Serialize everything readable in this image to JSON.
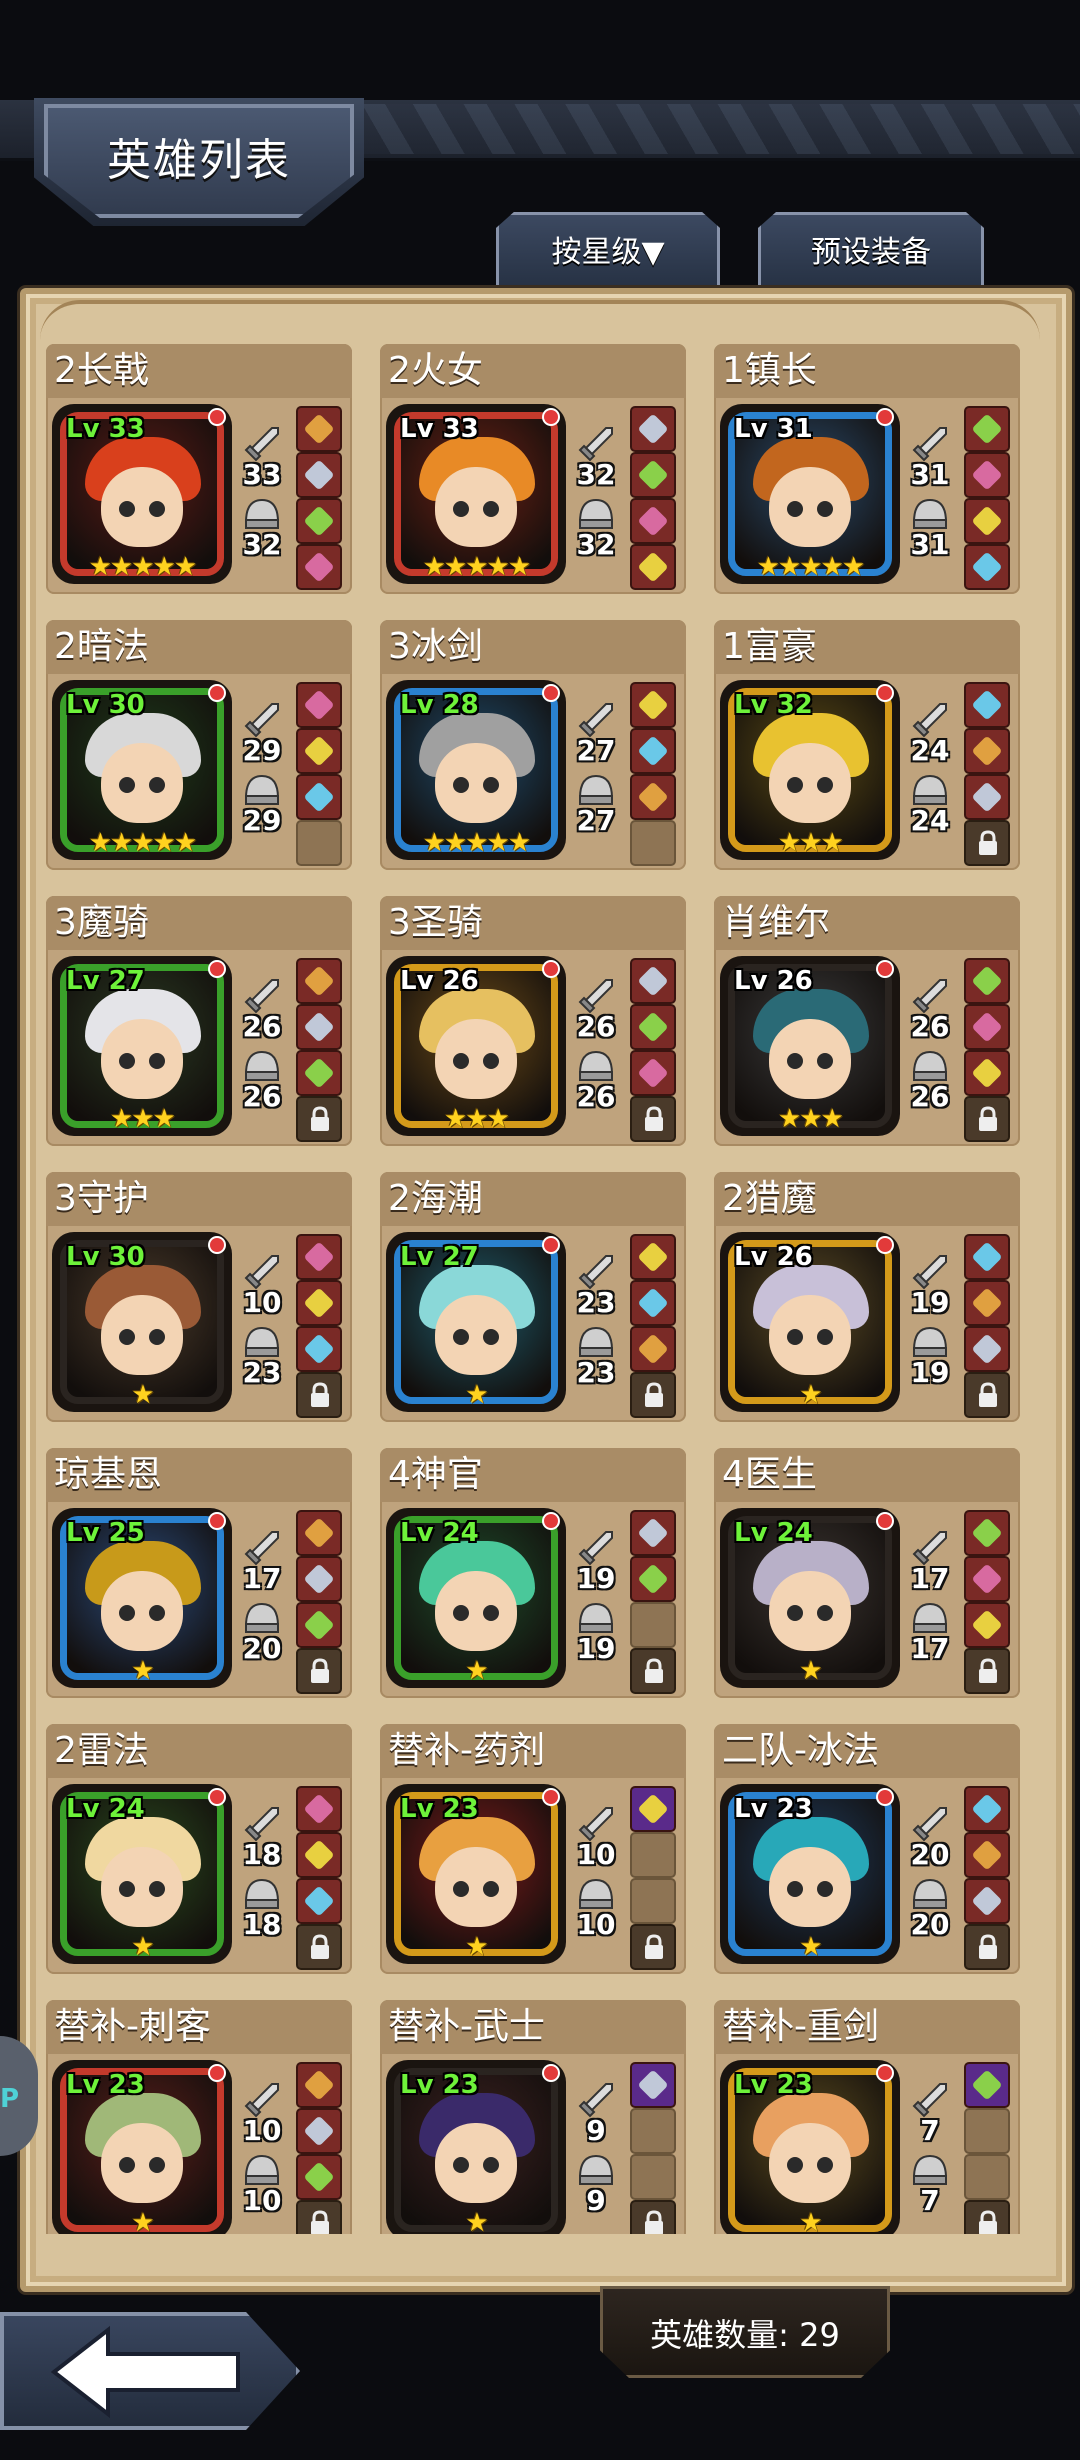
{
  "header": {
    "title": "英雄列表",
    "sort_button": "按星级▼",
    "preset_button": "预设装备"
  },
  "footer": {
    "hero_count": "英雄数量: 29",
    "side_tab": "P"
  },
  "colors": {
    "red_frame": "#c43a2c",
    "blue_frame": "#2a82d0",
    "green_frame": "#3aa02a",
    "gold_frame": "#d49a1a",
    "black_frame": "#2a2420",
    "level_green": "#6ef23a",
    "star": "#ffd21f"
  },
  "heroes": [
    {
      "name": "2长戟",
      "level": "Lv 33",
      "level_color": "green",
      "frame": "red",
      "stars": "★★★★★",
      "atk": "33",
      "def": "32",
      "equip": [
        "item",
        "item",
        "item",
        "item"
      ],
      "hair": "#d9401c",
      "bg": "#5a1a16"
    },
    {
      "name": "2火女",
      "level": "Lv 33",
      "level_color": "white",
      "frame": "red",
      "stars": "★★★★★",
      "atk": "32",
      "def": "32",
      "equip": [
        "item",
        "item",
        "item",
        "item"
      ],
      "hair": "#e88a26",
      "bg": "#6a2014"
    },
    {
      "name": "1镇长",
      "level": "Lv 31",
      "level_color": "white",
      "frame": "blue",
      "stars": "★★★★★",
      "atk": "31",
      "def": "31",
      "equip": [
        "item",
        "item",
        "item",
        "item"
      ],
      "hair": "#c2661e",
      "bg": "#2a4a6a"
    },
    {
      "name": "2暗法",
      "level": "Lv 30",
      "level_color": "green",
      "frame": "green",
      "stars": "★★★★★",
      "atk": "29",
      "def": "29",
      "equip": [
        "item",
        "item",
        "item",
        "empty"
      ],
      "hair": "#d8d8d8",
      "bg": "#1e3a1a"
    },
    {
      "name": "3冰剑",
      "level": "Lv 28",
      "level_color": "green",
      "frame": "blue",
      "stars": "★★★★★",
      "atk": "27",
      "def": "27",
      "equip": [
        "item",
        "item",
        "item",
        "empty"
      ],
      "hair": "#a0a0a0",
      "bg": "#1e4a6a"
    },
    {
      "name": "1富豪",
      "level": "Lv 32",
      "level_color": "green",
      "frame": "gold",
      "stars": "★★★",
      "atk": "24",
      "def": "24",
      "equip": [
        "item",
        "item",
        "item",
        "locked"
      ],
      "hair": "#e8c230",
      "bg": "#5a4a14"
    },
    {
      "name": "3魔骑",
      "level": "Lv 27",
      "level_color": "green",
      "frame": "green",
      "stars": "★★★",
      "atk": "26",
      "def": "26",
      "equip": [
        "item",
        "item",
        "item",
        "locked"
      ],
      "hair": "#e4e4e8",
      "bg": "#2a3a22"
    },
    {
      "name": "3圣骑",
      "level": "Lv 26",
      "level_color": "white",
      "frame": "gold",
      "stars": "★★★",
      "atk": "26",
      "def": "26",
      "equip": [
        "item",
        "item",
        "item",
        "locked"
      ],
      "hair": "#e6c060",
      "bg": "#6a4a18"
    },
    {
      "name": "肖维尔",
      "level": "Lv 26",
      "level_color": "white",
      "frame": "black",
      "stars": "★★★",
      "atk": "26",
      "def": "26",
      "equip": [
        "item",
        "item",
        "item",
        "locked"
      ],
      "hair": "#2a6a76",
      "bg": "#3a3a3a"
    },
    {
      "name": "3守护",
      "level": "Lv 30",
      "level_color": "green",
      "frame": "black",
      "stars": "★",
      "atk": "10",
      "def": "23",
      "equip": [
        "item",
        "item",
        "item",
        "locked"
      ],
      "hair": "#9a5a36",
      "bg": "#4a3a2a"
    },
    {
      "name": "2海潮",
      "level": "Lv 27",
      "level_color": "green",
      "frame": "blue",
      "stars": "★",
      "atk": "23",
      "def": "23",
      "equip": [
        "item",
        "item",
        "item",
        "locked"
      ],
      "hair": "#8ad8d8",
      "bg": "#1e5a6a"
    },
    {
      "name": "2猎魔",
      "level": "Lv 26",
      "level_color": "white",
      "frame": "gold",
      "stars": "★",
      "atk": "19",
      "def": "19",
      "equip": [
        "item",
        "item",
        "item",
        "locked"
      ],
      "hair": "#c8c0d8",
      "bg": "#5a4a24"
    },
    {
      "name": "琼基恩",
      "level": "Lv 25",
      "level_color": "green",
      "frame": "blue",
      "stars": "★",
      "atk": "17",
      "def": "20",
      "equip": [
        "item",
        "item",
        "item",
        "locked"
      ],
      "hair": "#c89a1a",
      "bg": "#2a4a7a"
    },
    {
      "name": "4神官",
      "level": "Lv 24",
      "level_color": "green",
      "frame": "green",
      "stars": "★",
      "atk": "19",
      "def": "19",
      "equip": [
        "item",
        "item",
        "empty",
        "locked"
      ],
      "hair": "#4ac89a",
      "bg": "#1e4a2a"
    },
    {
      "name": "4医生",
      "level": "Lv 24",
      "level_color": "green",
      "frame": "black",
      "stars": "★",
      "atk": "17",
      "def": "17",
      "equip": [
        "item",
        "item",
        "item",
        "locked"
      ],
      "hair": "#b8b0c8",
      "bg": "#3a3430"
    },
    {
      "name": "2雷法",
      "level": "Lv 24",
      "level_color": "green",
      "frame": "green",
      "stars": "★",
      "atk": "18",
      "def": "18",
      "equip": [
        "item",
        "item",
        "item",
        "locked"
      ],
      "hair": "#f0d8a0",
      "bg": "#2a4a1e"
    },
    {
      "name": "替补-药剂",
      "level": "Lv 23",
      "level_color": "green",
      "frame": "gold",
      "stars": "★",
      "atk": "10",
      "def": "10",
      "equip": [
        "purple",
        "empty",
        "empty",
        "locked"
      ],
      "hair": "#e8a040",
      "bg": "#7a1a1a"
    },
    {
      "name": "二队-冰法",
      "level": "Lv 23",
      "level_color": "white",
      "frame": "blue",
      "stars": "★",
      "atk": "20",
      "def": "20",
      "equip": [
        "item",
        "item",
        "item",
        "locked"
      ],
      "hair": "#28a8b8",
      "bg": "#1e3a5a"
    },
    {
      "name": "替补-刺客",
      "level": "Lv 23",
      "level_color": "green",
      "frame": "red",
      "stars": "★",
      "atk": "10",
      "def": "10",
      "equip": [
        "item",
        "item",
        "item",
        "locked"
      ],
      "hair": "#a0b878",
      "bg": "#5a1e1a"
    },
    {
      "name": "替补-武士",
      "level": "Lv 23",
      "level_color": "green",
      "frame": "black",
      "stars": "★",
      "atk": "9",
      "def": "9",
      "equip": [
        "purple",
        "empty",
        "empty",
        "locked"
      ],
      "hair": "#3a2a6a",
      "bg": "#3a2020"
    },
    {
      "name": "替补-重剑",
      "level": "Lv 23",
      "level_color": "green",
      "frame": "gold",
      "stars": "★",
      "atk": "7",
      "def": "7",
      "equip": [
        "purple",
        "empty",
        "empty",
        "locked"
      ],
      "hair": "#e8a060",
      "bg": "#5a4a1e"
    }
  ]
}
